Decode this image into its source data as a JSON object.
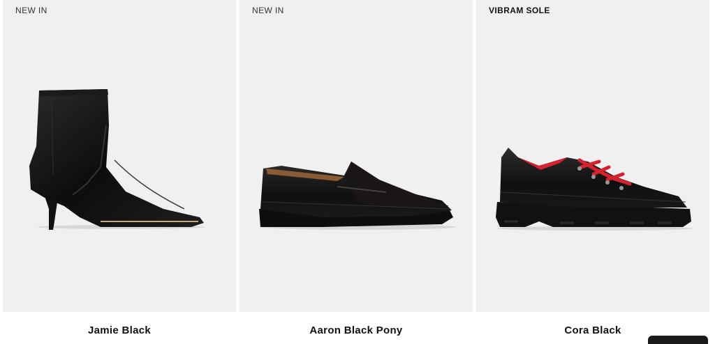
{
  "products": [
    {
      "badge": "NEW IN",
      "name": "Jamie Black",
      "icon": "ankle-boot-image"
    },
    {
      "badge": "NEW IN",
      "name": "Aaron Black Pony",
      "icon": "penny-loafer-image"
    },
    {
      "badge": "VIBRAM SOLE",
      "name": "Cora Black",
      "icon": "hiking-derby-image"
    }
  ],
  "colors": {
    "card_bg": "#f0f0f1",
    "leather": "#111111",
    "laces": "#d4222f"
  }
}
